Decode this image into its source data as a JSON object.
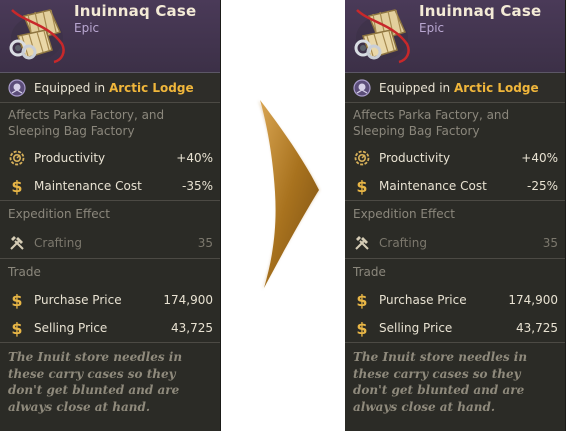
{
  "before": {
    "title": "Inuinnaq Case",
    "rarity": "Epic",
    "equipped_prefix": "Equipped in ",
    "equipped_place": "Arctic Lodge",
    "affects": "Affects Parka Factory, and Sleeping Bag Factory",
    "stats": [
      {
        "label": "Productivity",
        "value": "+40%",
        "icon": "productivity-gear-icon"
      },
      {
        "label": "Maintenance Cost",
        "value": "-35%",
        "icon": "coin-icon"
      }
    ],
    "expedition_title": "Expedition Effect",
    "expedition": {
      "label": "Crafting",
      "value": "35",
      "icon": "crafting-tools-icon"
    },
    "trade_title": "Trade",
    "trade": [
      {
        "label": "Purchase Price",
        "value": "174,900",
        "icon": "coin-icon"
      },
      {
        "label": "Selling Price",
        "value": "43,725",
        "icon": "coin-icon"
      }
    ],
    "flavor": "The Inuit store needles in these carry cases so they don't get blunted and are always close at hand."
  },
  "after": {
    "title": "Inuinnaq Case",
    "rarity": "Epic",
    "equipped_prefix": "Equipped in ",
    "equipped_place": "Arctic Lodge",
    "affects": "Affects Parka Factory, and Sleeping Bag Factory",
    "stats": [
      {
        "label": "Productivity",
        "value": "+40%",
        "icon": "productivity-gear-icon"
      },
      {
        "label": "Maintenance Cost",
        "value": "-25%",
        "icon": "coin-icon"
      }
    ],
    "expedition_title": "Expedition Effect",
    "expedition": {
      "label": "Crafting",
      "value": "35",
      "icon": "crafting-tools-icon"
    },
    "trade_title": "Trade",
    "trade": [
      {
        "label": "Purchase Price",
        "value": "174,900",
        "icon": "coin-icon"
      },
      {
        "label": "Selling Price",
        "value": "43,725",
        "icon": "coin-icon"
      }
    ],
    "flavor": "The Inuit store needles in these carry cases so they don't get blunted and are always close at hand."
  },
  "colors": {
    "card_bg": "#2b2b26",
    "header_bg": "#4a3a58",
    "place_accent": "#f0b63b",
    "arrow": "#a8721e"
  }
}
